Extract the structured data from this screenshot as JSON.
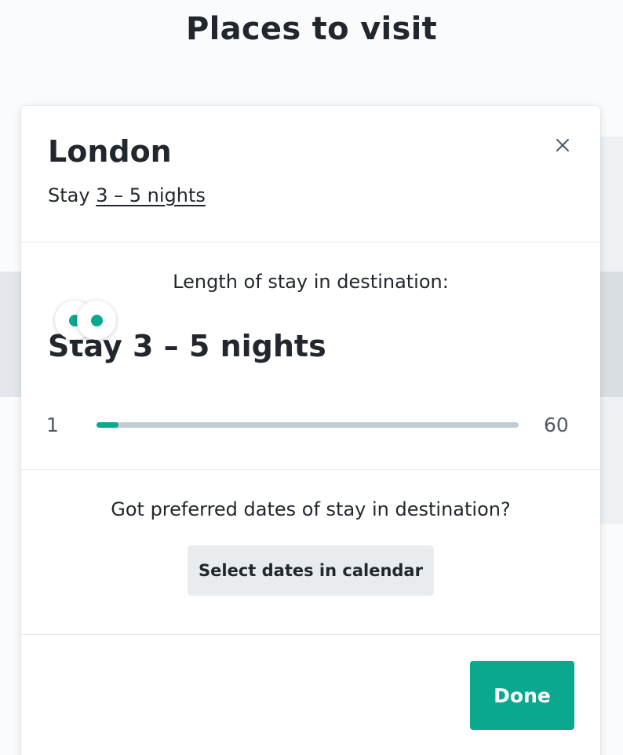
{
  "page": {
    "title": "Places to visit"
  },
  "modal": {
    "title": "London",
    "stay_prefix": "Stay",
    "stay_range": "3 – 5 nights",
    "length_label": "Length of stay in destination:",
    "stay_heading": "Stay 3 – 5 nights",
    "slider": {
      "min_label": "1",
      "max_label": "60",
      "min": 1,
      "max": 60,
      "value_low": 3,
      "value_high": 5
    },
    "dates_question": "Got preferred dates of stay in destination?",
    "calendar_button": "Select dates in calendar",
    "done_button": "Done"
  },
  "colors": {
    "accent": "#0aa88e",
    "secondary_button": "#e8ecef",
    "text": "#22272e"
  },
  "icons": {
    "close": "close-icon"
  }
}
